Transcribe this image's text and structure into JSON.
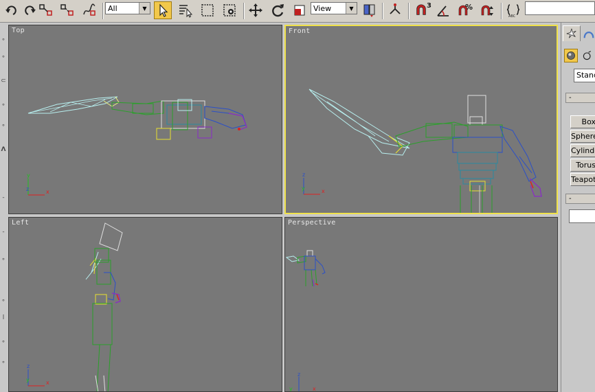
{
  "toolbar": {
    "selection_filter": "All",
    "reference_coord": "View",
    "snap_angle_label": "3",
    "percent_snap_label": "%",
    "named_selection": ""
  },
  "viewports": [
    {
      "label": "Top",
      "active": false
    },
    {
      "label": "Front",
      "active": true
    },
    {
      "label": "Left",
      "active": false
    },
    {
      "label": "Perspective",
      "active": false
    }
  ],
  "axes": {
    "top": {
      "v": "y",
      "h": "x"
    },
    "front": {
      "v": "z",
      "h": "x"
    },
    "left": {
      "v": "z",
      "h": "x"
    },
    "persp": {
      "v": "z",
      "h": "x"
    }
  },
  "command_panel": {
    "object_type": "Standard Primitives",
    "rollout_object_type": "-",
    "rollout_name_color": "-",
    "primitives": [
      "Box",
      "Sphere",
      "Cylinder",
      "Torus",
      "Teapot"
    ]
  },
  "colors": {
    "accent": "#f0e24a",
    "viewport_bg": "#787878",
    "wire_cyan": "#b8f0f0",
    "wire_green": "#2aa02a",
    "wire_blue": "#2a4fc8",
    "wire_purple": "#8a2ac8"
  }
}
